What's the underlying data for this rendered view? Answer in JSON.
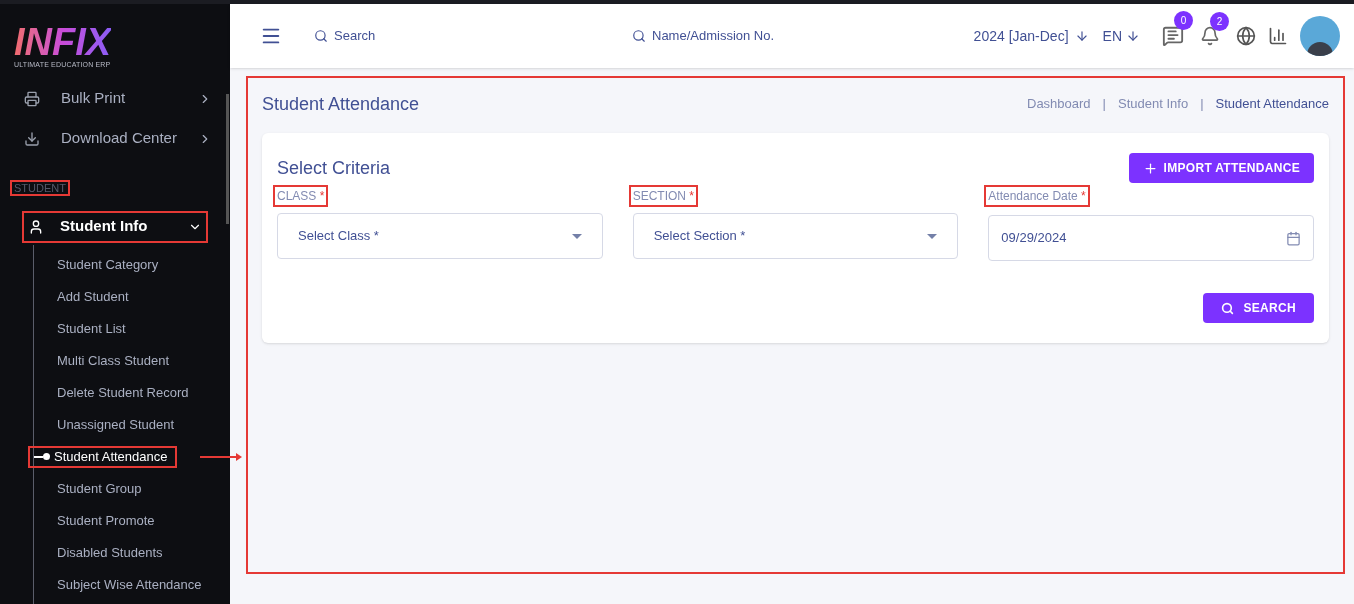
{
  "logo": {
    "title": "INFIX",
    "subtitle": "ULTIMATE EDUCATION ERP"
  },
  "sidebar": {
    "menus": [
      {
        "label": "Bulk Print"
      },
      {
        "label": "Download Center"
      }
    ],
    "section": {
      "label": "STUDENT",
      "highlighted": true
    },
    "group": {
      "label": "Student Info",
      "expanded": true,
      "highlighted": true,
      "children": [
        {
          "label": "Student Category",
          "selected": false
        },
        {
          "label": "Add Student",
          "selected": false
        },
        {
          "label": "Student List",
          "selected": false
        },
        {
          "label": "Multi Class Student",
          "selected": false
        },
        {
          "label": "Delete Student Record",
          "selected": false
        },
        {
          "label": "Unassigned Student",
          "selected": false
        },
        {
          "label": "Student Attendance",
          "selected": true
        },
        {
          "label": "Student Group",
          "selected": false
        },
        {
          "label": "Student Promote",
          "selected": false
        },
        {
          "label": "Disabled Students",
          "selected": false
        },
        {
          "label": "Subject Wise Attendance",
          "selected": false
        }
      ]
    }
  },
  "header": {
    "search": {
      "placeholder": "Search"
    },
    "student_search": {
      "placeholder": "Name/Admission No."
    },
    "session": "2024 [Jan-Dec]",
    "language": "EN",
    "messages_badge": "0",
    "notifications_badge": "2"
  },
  "page": {
    "title": "Student Attendance",
    "highlighted": true,
    "breadcrumbs": [
      {
        "label": "Dashboard",
        "selected": false
      },
      {
        "label": "Student Info",
        "selected": false
      },
      {
        "label": "Student Attendance",
        "selected": true
      }
    ],
    "separator": "|"
  },
  "card": {
    "title": "Select Criteria",
    "import_button": "IMPORT ATTENDANCE",
    "search_button": "SEARCH",
    "fields": [
      {
        "kind": "select",
        "label": "CLASS",
        "required": "*",
        "placeholder": "Select Class *",
        "highlighted": true
      },
      {
        "kind": "select",
        "label": "SECTION",
        "required": "*",
        "placeholder": "Select Section *",
        "highlighted": true
      },
      {
        "kind": "date",
        "label": "Attendance Date",
        "required": "*",
        "value": "09/29/2024",
        "highlighted": true
      }
    ]
  }
}
